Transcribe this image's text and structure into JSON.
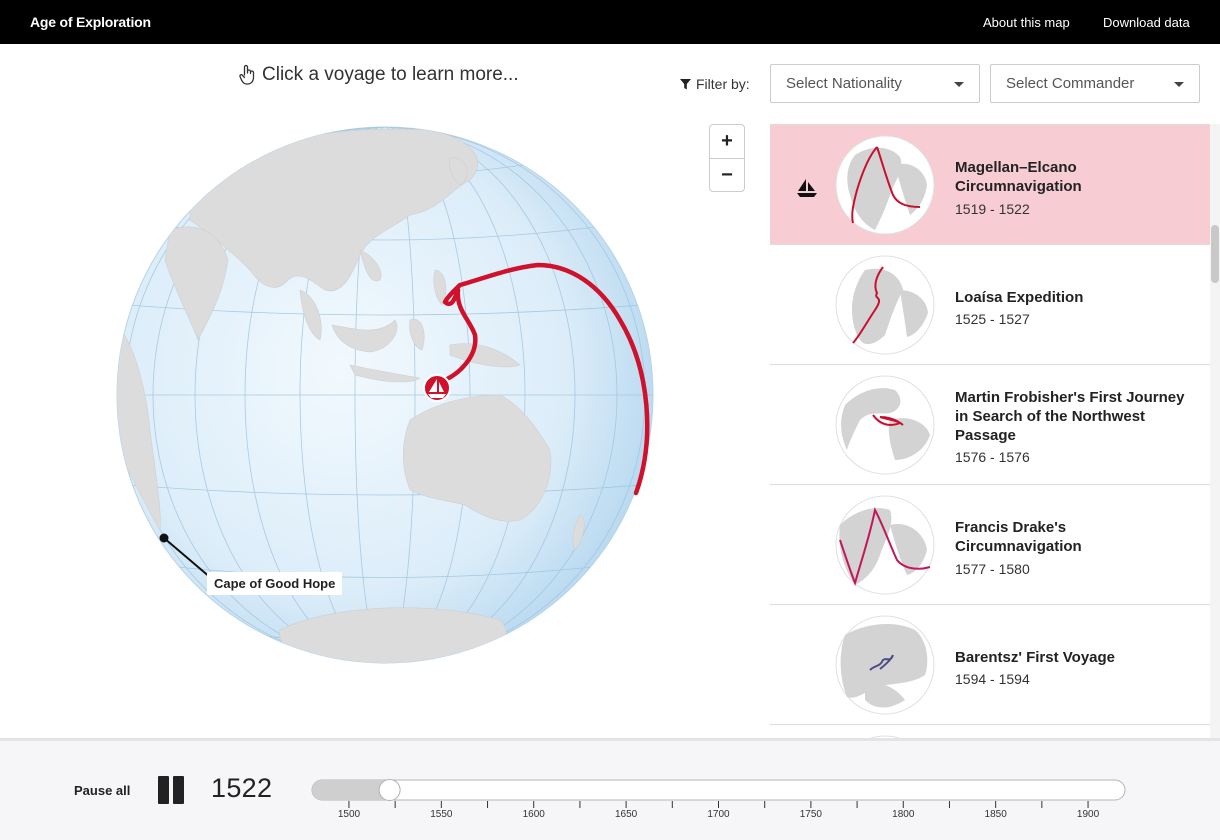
{
  "header": {
    "brand": "Age of Exploration",
    "nav": [
      "About this map",
      "Download data"
    ]
  },
  "hint": "Click a voyage to learn more...",
  "filters": {
    "label": "Filter by:",
    "nationality_placeholder": "Select Nationality",
    "commander_placeholder": "Select Commander"
  },
  "zoom": {
    "in": "+",
    "out": "−"
  },
  "map": {
    "annotation": "Cape of Good Hope",
    "route_color": "#d0112b",
    "ocean_color": "#d6ebf8",
    "land_color": "#dcdcdc"
  },
  "voyages": [
    {
      "title": "Magellan–Elcano Circumnavigation",
      "years": "1519 - 1522",
      "active": true,
      "color": "#c8102e"
    },
    {
      "title": "Loaísa Expedition",
      "years": "1525 - 1527",
      "active": false,
      "color": "#c8102e"
    },
    {
      "title": "Martin Frobisher's First Journey in Search of the Northwest Passage",
      "years": "1576 - 1576",
      "active": false,
      "color": "#c8102e"
    },
    {
      "title": "Francis Drake's Circumnavigation",
      "years": "1577 - 1580",
      "active": false,
      "color": "#c2185b"
    },
    {
      "title": "Barentsz' First Voyage",
      "years": "1594 - 1594",
      "active": false,
      "color": "#4a4a8a"
    }
  ],
  "playback": {
    "pause_label": "Pause all",
    "current_year": "1522",
    "min_year": 1480,
    "max_year": 1920,
    "tick_labels": [
      "1500",
      "1550",
      "1600",
      "1650",
      "1700",
      "1750",
      "1800",
      "1850",
      "1900"
    ]
  }
}
